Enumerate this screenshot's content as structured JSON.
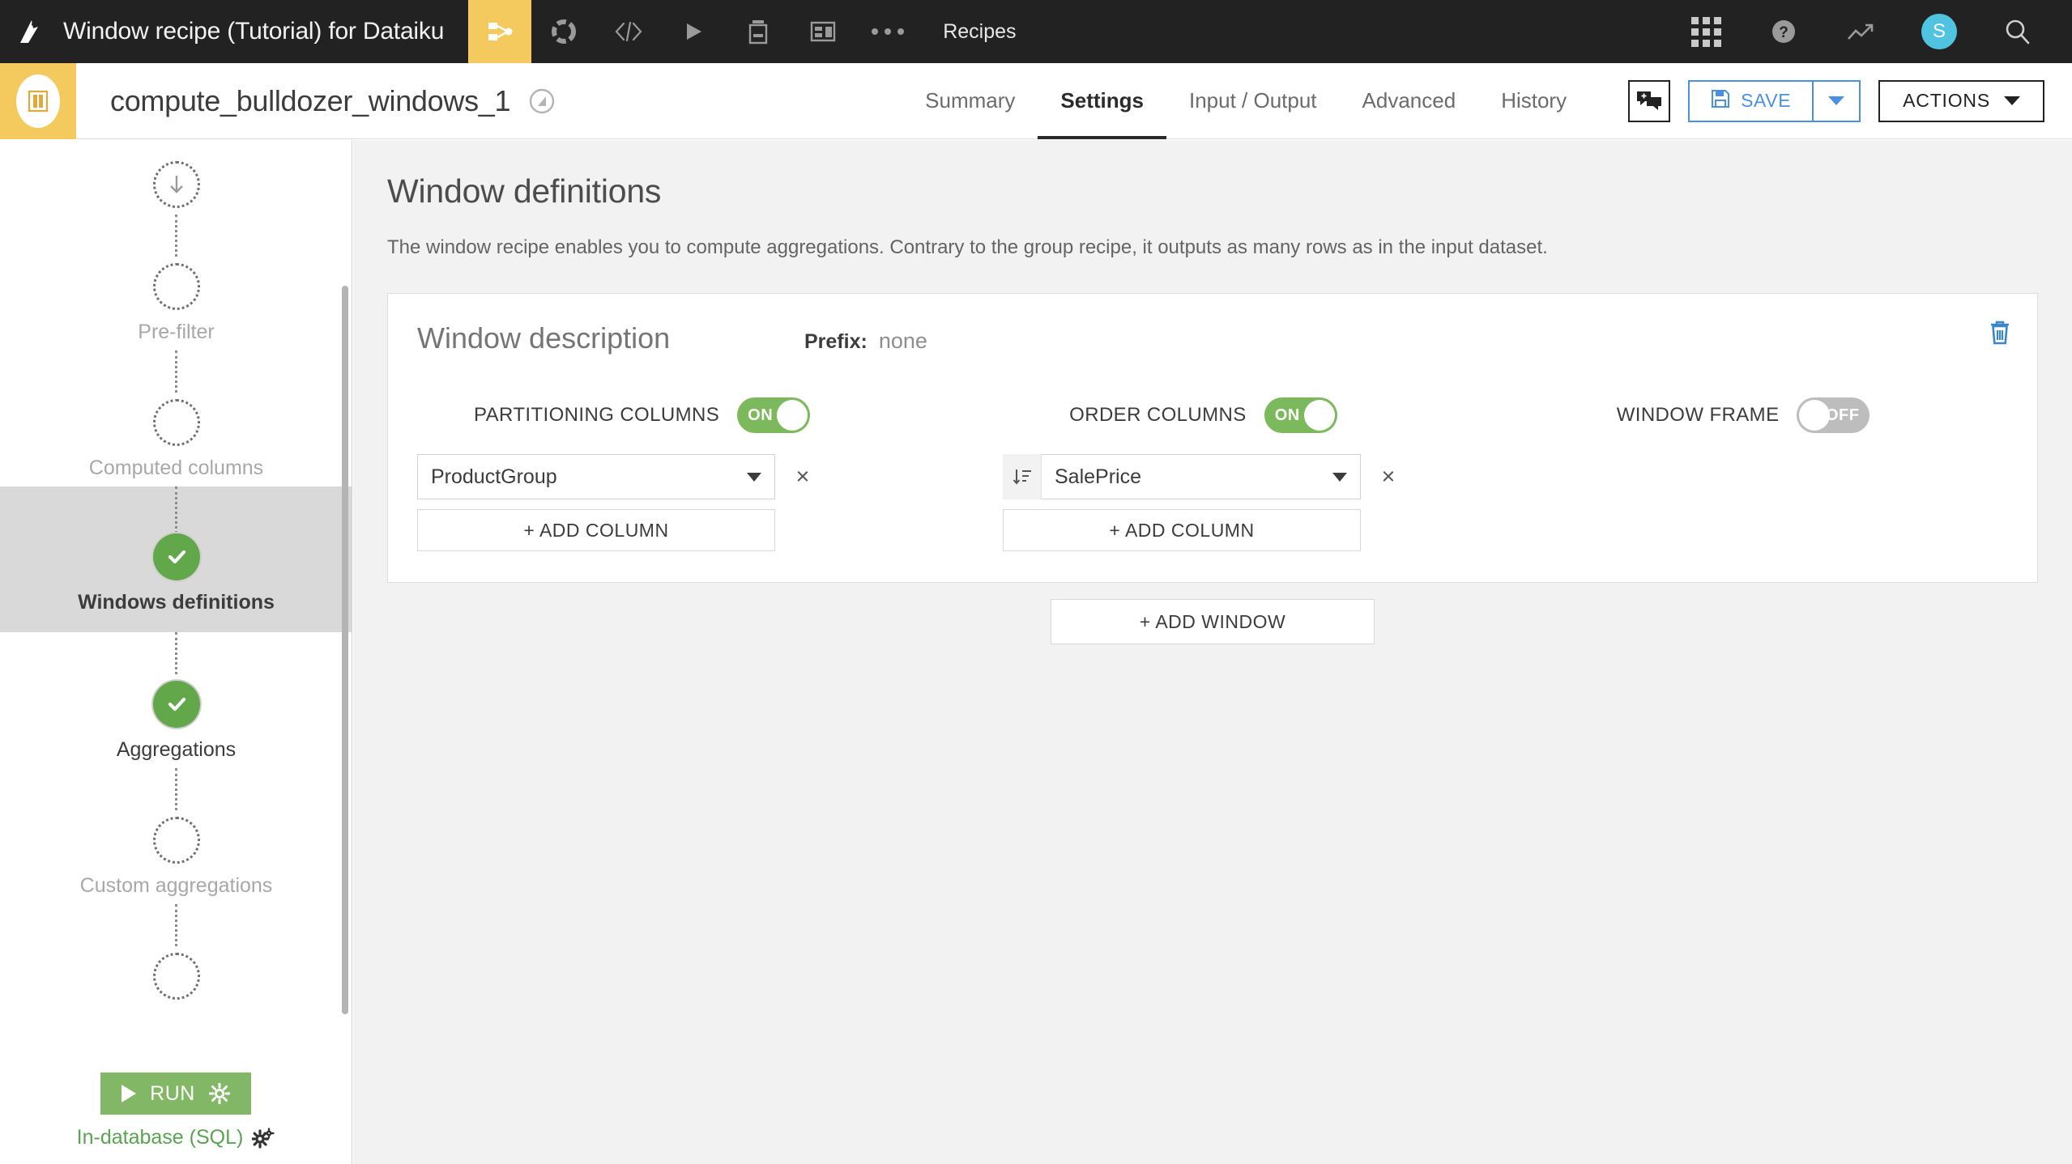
{
  "navbar": {
    "logo_icon": "dataiku-bird-logo-icon",
    "title": "Window recipe (Tutorial) for Dataiku",
    "items": [
      {
        "icon": "flow-icon",
        "name": "flow"
      },
      {
        "icon": "dashboard-wheel-icon",
        "name": "dashboards"
      },
      {
        "icon": "code-icon",
        "name": "code"
      },
      {
        "icon": "play-icon",
        "name": "automation"
      },
      {
        "icon": "jobs-icon",
        "name": "jobs"
      },
      {
        "icon": "wiki-icon",
        "name": "wiki"
      },
      {
        "icon": "more-dots-icon",
        "name": "more"
      }
    ],
    "section_label": "Recipes",
    "right_items": [
      {
        "icon": "apps-grid-icon",
        "name": "apps"
      },
      {
        "icon": "help-icon",
        "name": "help"
      },
      {
        "icon": "trend-icon",
        "name": "activity"
      },
      {
        "icon": "avatar-icon",
        "name": "user",
        "initial": "S"
      },
      {
        "icon": "search-icon",
        "name": "search"
      }
    ]
  },
  "subheader": {
    "recipe_icon": "window-recipe-icon",
    "recipe_name": "compute_bulldozer_windows_1",
    "compass_icon": "compass-icon",
    "tabs": [
      {
        "label": "Summary",
        "active": false
      },
      {
        "label": "Settings",
        "active": true
      },
      {
        "label": "Input / Output",
        "active": false
      },
      {
        "label": "Advanced",
        "active": false
      },
      {
        "label": "History",
        "active": false
      }
    ],
    "discussions_icon": "discussions-add-icon",
    "save_label": "SAVE",
    "save_icon": "floppy-disk-icon",
    "save_caret_icon": "caret-down-icon",
    "actions_label": "ACTIONS",
    "actions_caret_icon": "caret-down-icon"
  },
  "sidebar": {
    "steps": [
      {
        "label": "",
        "state": "input",
        "icon": "arrow-down-icon"
      },
      {
        "label": "Pre-filter",
        "state": "empty"
      },
      {
        "label": "Computed columns",
        "state": "empty"
      },
      {
        "label": "Windows definitions",
        "state": "done",
        "active": true
      },
      {
        "label": "Aggregations",
        "state": "done"
      },
      {
        "label": "Custom aggregations",
        "state": "empty"
      },
      {
        "label": "",
        "state": "empty"
      }
    ],
    "run_label": "RUN",
    "run_gear_icon": "gear-icon",
    "engine_label": "In-database (SQL)",
    "engine_gear_icon": "gears-icon"
  },
  "main": {
    "title": "Window definitions",
    "description": "The window recipe enables you to compute aggregations. Contrary to the group recipe, it outputs as many rows as in the input dataset.",
    "card": {
      "description_placeholder": "Window description",
      "description_value": "",
      "prefix_label": "Prefix:",
      "prefix_value": "none",
      "delete_icon": "trash-icon",
      "partitioning": {
        "label": "PARTITIONING COLUMNS",
        "toggle_state": "ON",
        "columns": [
          {
            "value": "ProductGroup"
          }
        ],
        "add_label": "+ ADD COLUMN",
        "remove_label": "×"
      },
      "order": {
        "label": "ORDER COLUMNS",
        "toggle_state": "ON",
        "columns": [
          {
            "value": "SalePrice",
            "sort_icon": "sort-descending-icon"
          }
        ],
        "add_label": "+ ADD COLUMN",
        "remove_label": "×"
      },
      "window_frame": {
        "label": "WINDOW FRAME",
        "toggle_state": "OFF"
      }
    },
    "add_window_label": "+ ADD WINDOW"
  },
  "colors": {
    "navbar_bg": "#222222",
    "accent_yellow": "#f4c95d",
    "toggle_on_green": "#7cb85c",
    "toggle_off_gray": "#bdbdbd",
    "done_green": "#62a84a",
    "run_green": "#82b865",
    "save_blue": "#4a90e2",
    "trash_blue": "#3a86c8",
    "avatar_blue": "#4fc3e0",
    "main_bg": "#f2f2f2"
  }
}
